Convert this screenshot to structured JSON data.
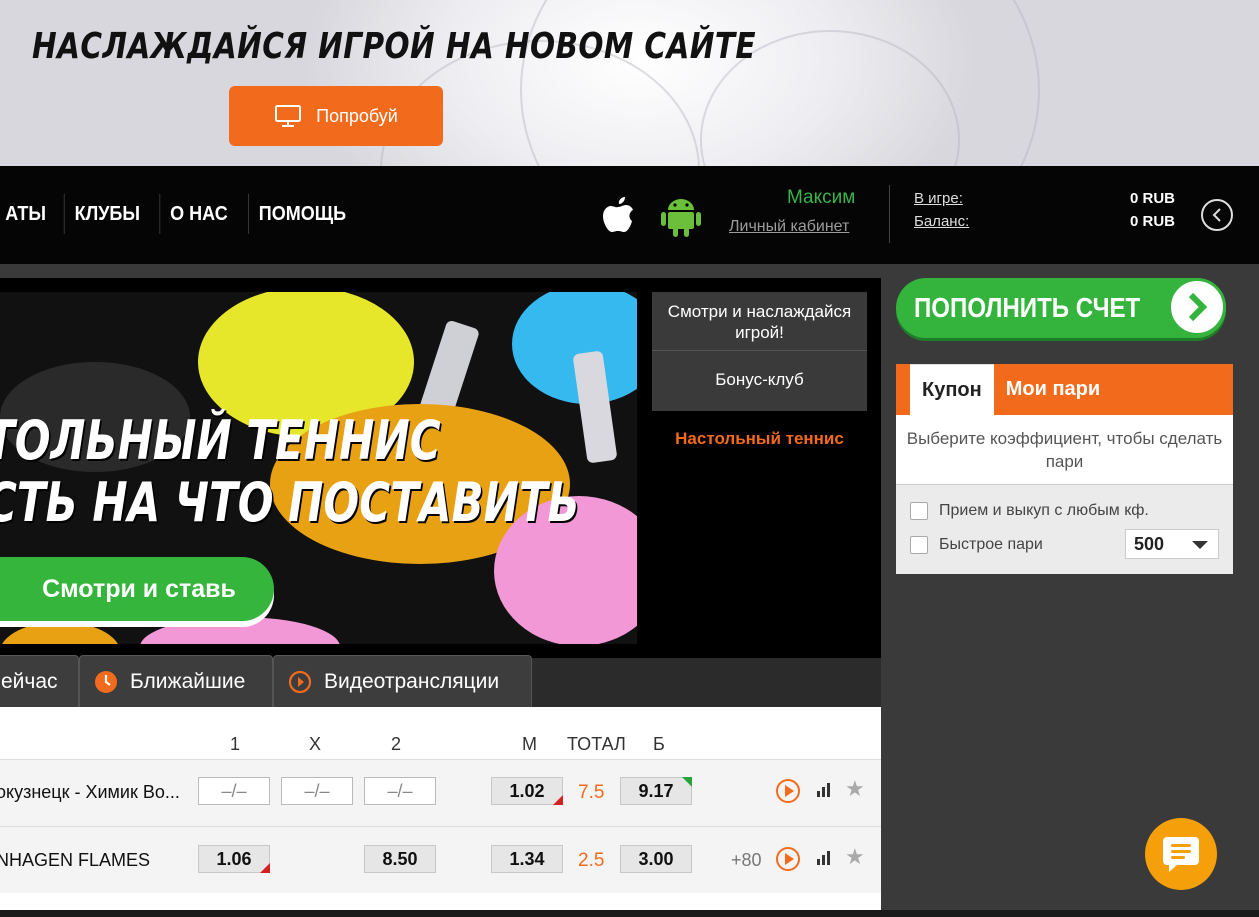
{
  "promo": {
    "title": "НАСЛАЖДАЙСЯ ИГРОЙ НА НОВОМ САЙТЕ",
    "button_label": "Попробуй",
    "button_icon": "monitor-icon"
  },
  "nav": {
    "menu": [
      "АТЫ",
      "КЛУБЫ",
      "О НАС",
      "ПОМОЩЬ"
    ],
    "user_name": "Максим",
    "cabinet_link": "Личный кабинет",
    "in_game_label": "В игре:",
    "in_game_value": "0 RUB",
    "balance_label": "Баланс:",
    "balance_value": "0 RUB"
  },
  "hero": {
    "title_line1": "ТОЛЬНЫЙ ТЕННИС",
    "title_line2": "СТЬ НА ЧТО ПОСТАВИТЬ",
    "button_label": "Смотри и ставь"
  },
  "side_menu": {
    "items": [
      "Смотри и наслаждайся игрой!",
      "Бонус-клуб"
    ],
    "active": "Настольный теннис"
  },
  "tabs": [
    "ейчас",
    "Ближайшие",
    "Видеотрансляции"
  ],
  "table": {
    "headers": [
      "1",
      "X",
      "2",
      "М",
      "ТОТАЛ",
      "Б"
    ],
    "rows": [
      {
        "match": "окузнецк - Химик Во...",
        "o1": "–/–",
        "ox": "–/–",
        "o2": "–/–",
        "m": "1.02",
        "total": "7.5",
        "b": "9.17",
        "more": ""
      },
      {
        "match": "NHAGEN FLAMES",
        "o1": "1.06",
        "ox": "",
        "o2": "8.50",
        "m": "1.34",
        "total": "2.5",
        "b": "3.00",
        "more": "+80"
      }
    ]
  },
  "deposit": {
    "label": "ПОПОЛНИТЬ СЧЕТ"
  },
  "coupon": {
    "tab_active": "Купон",
    "tab_other": "Мои пари",
    "hint": "Выберите коэффициент, чтобы сделать пари",
    "option1": "Прием и выкуп с любым кф.",
    "option2": "Быстрое пари",
    "quick_amount": "500"
  },
  "colors": {
    "accent": "#f26b1d",
    "green": "#34b43c",
    "chat": "#f5a00b"
  }
}
